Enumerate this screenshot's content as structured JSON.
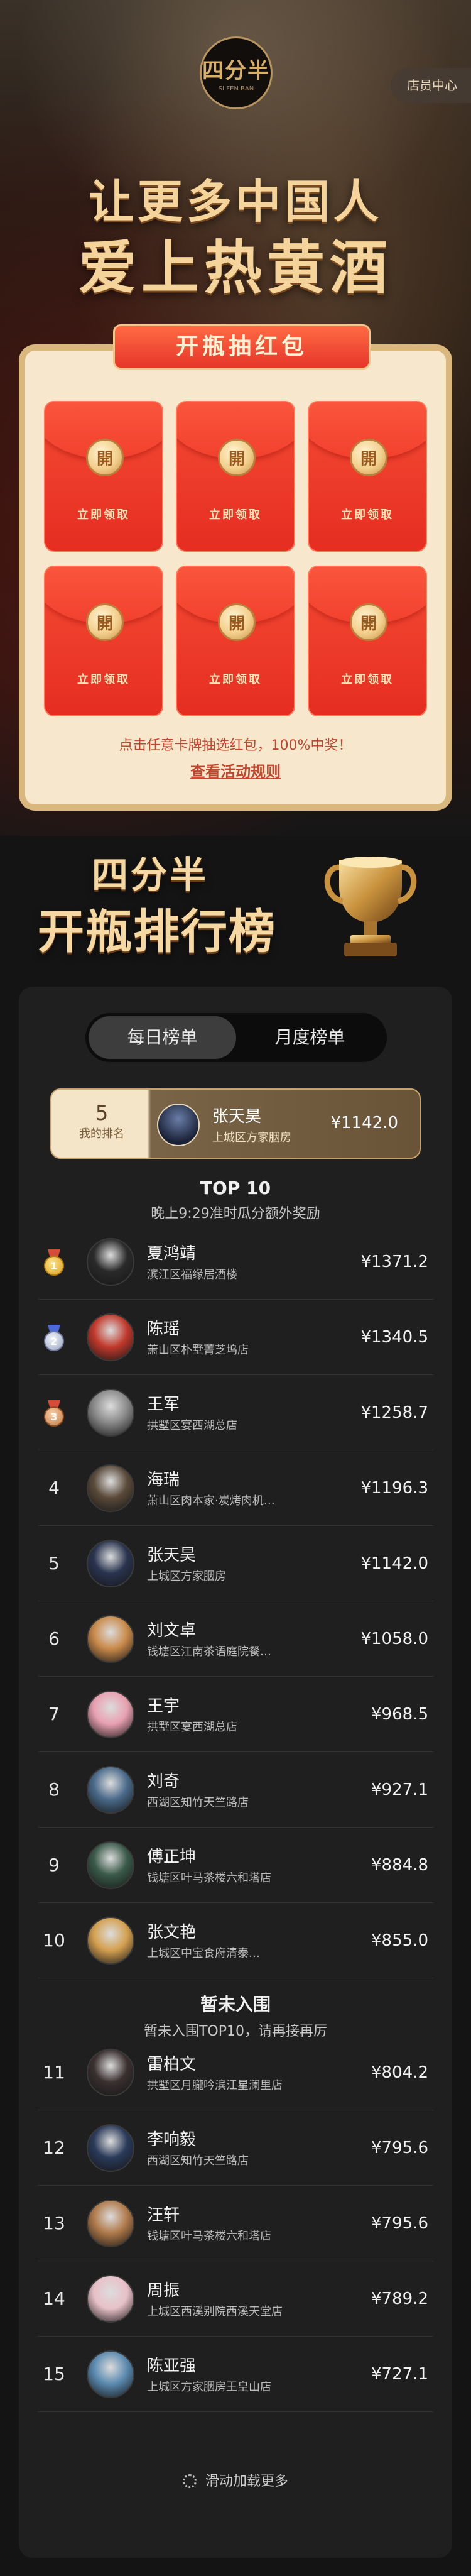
{
  "header": {
    "logo_text": "四分半",
    "logo_sub": "SI FEN BAN",
    "store_center": "店员中心"
  },
  "slogan": {
    "line1": "让更多中国人",
    "line2": "爱上热黄酒"
  },
  "lottery": {
    "title": "开瓶抽红包",
    "packets": [
      {
        "coin": "開",
        "label": "立即领取"
      },
      {
        "coin": "開",
        "label": "立即领取"
      },
      {
        "coin": "開",
        "label": "立即领取"
      },
      {
        "coin": "開",
        "label": "立即领取"
      },
      {
        "coin": "開",
        "label": "立即领取"
      },
      {
        "coin": "開",
        "label": "立即领取"
      }
    ],
    "tip": "点击任意卡牌抽选红包，100%中奖！",
    "rules_link": "查看活动规则"
  },
  "ranking": {
    "brand": "四分半",
    "title": "开瓶排行榜",
    "tabs": [
      {
        "label": "每日榜单",
        "active": true
      },
      {
        "label": "月度榜单",
        "active": false
      }
    ],
    "me": {
      "rank": "5",
      "rank_label": "我的排名",
      "name": "张天昊",
      "store": "上城区方家胭房",
      "amount": "¥1142.0"
    },
    "top_title": "TOP 10",
    "top_subtitle": "晚上9:29准时瓜分额外奖励",
    "top_list": [
      {
        "rank": "1",
        "medal": "gold",
        "name": "夏鸿靖",
        "store": "滨江区福缘居酒楼",
        "amount": "¥1371.2",
        "avatar_color": "#2a2a2a"
      },
      {
        "rank": "2",
        "medal": "silver",
        "name": "陈瑶",
        "store": "萧山区朴墅菁芝坞店",
        "amount": "¥1340.5",
        "avatar_color": "#c0392b"
      },
      {
        "rank": "3",
        "medal": "bronze",
        "name": "王军",
        "store": "拱墅区宴西湖总店",
        "amount": "¥1258.7",
        "avatar_color": "#8a8a8a"
      },
      {
        "rank": "4",
        "medal": "",
        "name": "海瑞",
        "store": "萧山区肉本家·炭烤肉机…",
        "amount": "¥1196.3",
        "avatar_color": "#5a4a3a"
      },
      {
        "rank": "5",
        "medal": "",
        "name": "张天昊",
        "store": "上城区方家胭房",
        "amount": "¥1142.0",
        "avatar_color": "#2a3450"
      },
      {
        "rank": "6",
        "medal": "",
        "name": "刘文卓",
        "store": "钱塘区江南茶语庭院餐…",
        "amount": "¥1058.0",
        "avatar_color": "#c98a4a"
      },
      {
        "rank": "7",
        "medal": "",
        "name": "王宇",
        "store": "拱墅区宴西湖总店",
        "amount": "¥968.5",
        "avatar_color": "#e8a0b0"
      },
      {
        "rank": "8",
        "medal": "",
        "name": "刘奇",
        "store": "西湖区知竹天竺路店",
        "amount": "¥927.1",
        "avatar_color": "#4a6a8a"
      },
      {
        "rank": "9",
        "medal": "",
        "name": "傅正坤",
        "store": "钱塘区叶马茶楼六和塔店",
        "amount": "¥884.8",
        "avatar_color": "#3a5a4a"
      },
      {
        "rank": "10",
        "medal": "",
        "name": "张文艳",
        "store": "上城区中宝食府清泰…",
        "amount": "¥855.0",
        "avatar_color": "#d4a050"
      }
    ],
    "out_title": "暂未入围",
    "out_subtitle": "暂未入围TOP10，请再接再厉",
    "out_list": [
      {
        "rank": "11",
        "name": "雷柏文",
        "store": "拱墅区月朧吟滨江星澜里店",
        "amount": "¥804.2",
        "avatar_color": "#3a3030"
      },
      {
        "rank": "12",
        "name": "李响毅",
        "store": "西湖区知竹天竺路店",
        "amount": "¥795.6",
        "avatar_color": "#2a3a5a"
      },
      {
        "rank": "13",
        "name": "汪轩",
        "store": "钱塘区叶马茶楼六和塔店",
        "amount": "¥795.6",
        "avatar_color": "#b07a4a"
      },
      {
        "rank": "14",
        "name": "周振",
        "store": "上城区西溪别院西溪天堂店",
        "amount": "¥789.2",
        "avatar_color": "#e8c0c8"
      },
      {
        "rank": "15",
        "name": "陈亚强",
        "store": "上城区方家胭房王皇山店",
        "amount": "¥727.1",
        "avatar_color": "#5a8ab0"
      }
    ],
    "load_more": "滑动加载更多"
  }
}
